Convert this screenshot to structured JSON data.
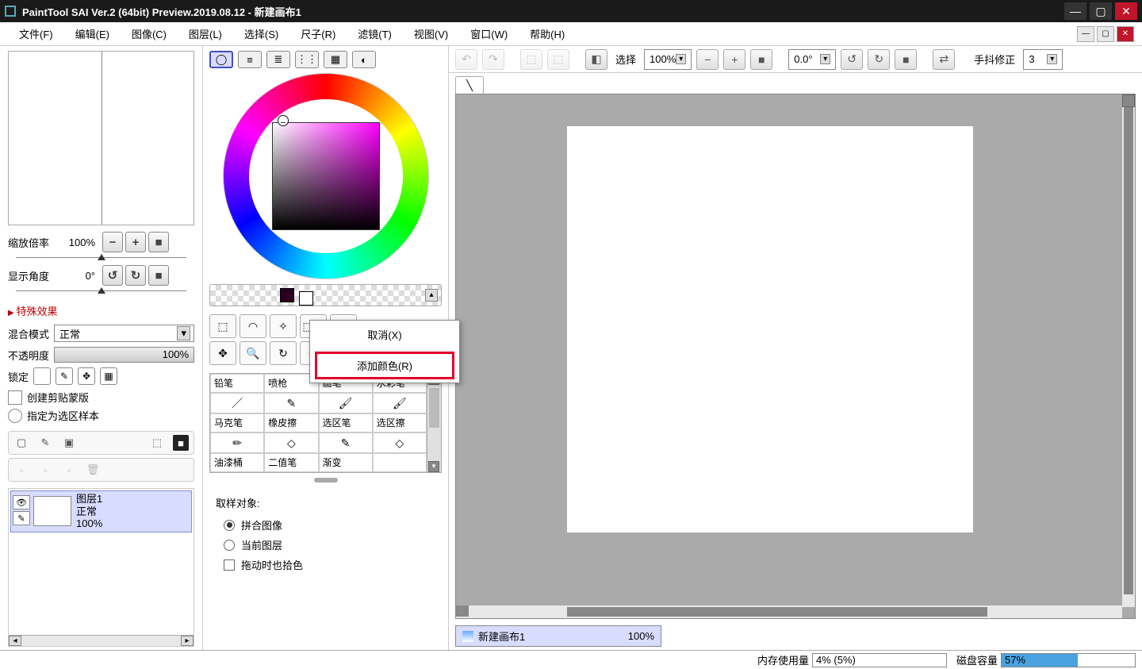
{
  "window": {
    "title": "PaintTool SAI Ver.2 (64bit) Preview.2019.08.12 - 新建画布1"
  },
  "menu": {
    "file": "文件(F)",
    "edit": "编辑(E)",
    "image": "图像(C)",
    "layer": "图层(L)",
    "select": "选择(S)",
    "ruler": "尺子(R)",
    "filter": "滤镜(T)",
    "view": "视图(V)",
    "window": "窗口(W)",
    "help": "帮助(H)"
  },
  "nav": {
    "zoom_label": "缩放倍率",
    "zoom_value": "100%",
    "angle_label": "显示角度",
    "angle_value": "0°"
  },
  "effects": {
    "header": "特殊效果"
  },
  "blend": {
    "label": "混合模式",
    "value": "正常"
  },
  "opacity": {
    "label": "不透明度",
    "value": "100%"
  },
  "lock": {
    "label": "锁定"
  },
  "clip": {
    "label": "创建剪贴蒙版"
  },
  "assign": {
    "label": "指定为选区样本"
  },
  "layer": {
    "name": "图层1",
    "mode": "正常",
    "opacity": "100%"
  },
  "context_menu": {
    "cancel": "取消(X)",
    "add_color": "添加颜色(R)"
  },
  "brushes": {
    "r1": [
      "铅笔",
      "喷枪",
      "画笔",
      "水彩笔"
    ],
    "r2": [
      "马克笔",
      "橡皮擦",
      "选区笔",
      "选区擦"
    ],
    "r3": [
      "油漆桶",
      "二值笔",
      "渐变",
      ""
    ]
  },
  "sampling": {
    "header": "取样对象:",
    "merged": "拼合图像",
    "current": "当前图层",
    "drag": "拖动时也拾色"
  },
  "toolbar": {
    "select_label": "选择",
    "zoom": "100%",
    "angle": "0.0°",
    "stab_label": "手抖修正",
    "stab_value": "3"
  },
  "doc": {
    "name": "新建画布1",
    "zoom": "100%"
  },
  "status": {
    "mem_label": "内存使用量",
    "mem_value": "4% (5%)",
    "disk_label": "磁盘容量",
    "disk_value": "57%"
  }
}
